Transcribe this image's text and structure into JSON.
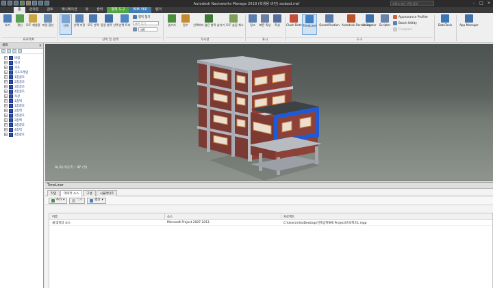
{
  "window": {
    "title": "Autodesk Navisworks Manage 2018 (학생용 버전)   asdasd.nwf",
    "search_placeholder": "키워드 또는 구절 입력"
  },
  "ribbon_tabs": [
    "홈",
    "관측점",
    "검토",
    "애니메이션",
    "뷰",
    "출력",
    "항목 도구",
    "BIM 360",
    "렌더"
  ],
  "ribbon": {
    "buttons": [
      {
        "label": "추가",
        "color": "#4f7db8"
      },
      {
        "label": "갱신",
        "color": "#58a04c"
      },
      {
        "label": "모두 재설정",
        "color": "#c9a642"
      },
      {
        "label": "파일 옵션",
        "color": "#6b8fb5"
      },
      {
        "label": "선택",
        "color": "#7aa3cf"
      },
      {
        "label": "선택 저장",
        "color": "#5c86b8"
      },
      {
        "label": "모두 선택",
        "color": "#4a78b0"
      },
      {
        "label": "동일 항목 선택",
        "color": "#3f6fa8"
      },
      {
        "label": "선택 트리",
        "color": "#4d88c2"
      },
      {
        "label": "숨기기",
        "color": "#4c8e3e"
      },
      {
        "label": "필수",
        "color": "#c48a2d"
      },
      {
        "label": "선택하지 않은 항목 숨기기",
        "color": "#3e7a35"
      },
      {
        "label": "모두 숨김 취소",
        "color": "#7e9e5a"
      },
      {
        "label": "링크",
        "color": "#5a7fae"
      },
      {
        "label": "빠른 특성",
        "color": "#6b7fa3"
      },
      {
        "label": "특성",
        "color": "#536f9a"
      },
      {
        "label": "Clash Detective",
        "color": "#c44e3b"
      },
      {
        "label": "TimeLiner",
        "color": "#3f7fc4"
      },
      {
        "label": "Quantification",
        "color": "#5a7ba8"
      },
      {
        "label": "Autodesk Rendering",
        "color": "#b6542e"
      },
      {
        "label": "Animator",
        "color": "#3e6fa6"
      },
      {
        "label": "Scripter",
        "color": "#6a83a8"
      },
      {
        "label": "DataTools",
        "color": "#3b77b7"
      },
      {
        "label": "App Manager",
        "color": "#4571a9"
      }
    ],
    "small_items": {
      "find_items": "항목 찾기",
      "quick_find_placeholder": "빠른 찾기",
      "selection_set": "세트",
      "appearance_profiler": "Appearance Profiler",
      "batch_utility": "Batch Utility",
      "compare": "Compare"
    },
    "groups": [
      "프로젝트",
      "선택 및 검색",
      "가시성",
      "표시",
      "도구"
    ]
  },
  "selection_tree": {
    "title": "세트",
    "items": [
      "버림",
      "벽선",
      "기초",
      "기초프레임",
      "1층골조",
      "2층골조",
      "3층골조",
      "4층골조",
      "옥상",
      "1층벽",
      "1층창호",
      "2층벽",
      "2층창호",
      "3층벽",
      "3층창호",
      "4층벽",
      "4층창호"
    ]
  },
  "viewport": {
    "status": "A(-6)-5(17) : 4F (3)"
  },
  "timeliner": {
    "title": "TimeLiner",
    "tabs": [
      "작업",
      "데이터 소스",
      "구성",
      "시뮬레이트"
    ],
    "active_tab": 1,
    "toolbar": {
      "add": "추가",
      "delete": "삭제",
      "refresh": "갱신"
    },
    "columns": [
      "이름",
      "소스",
      "프로젝트"
    ],
    "rows": [
      [
        "새 데이터 소스",
        "Microsoft Project 2007-2013",
        "C:\\Users\\nho\\Desktop\\건축공학\\MS Project\\프로젝트1.mpp"
      ]
    ]
  }
}
